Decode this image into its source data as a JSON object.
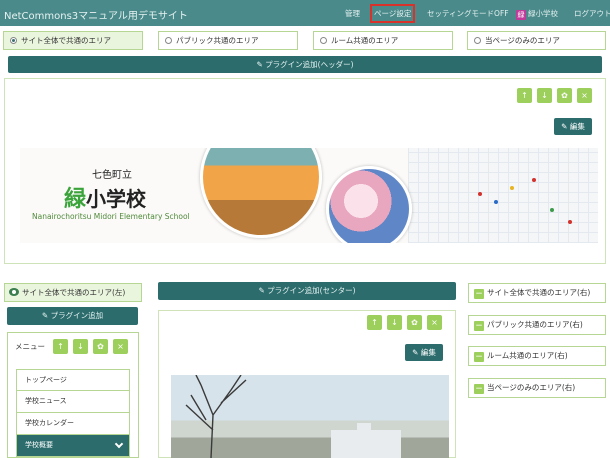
{
  "navbar": {
    "brand": "NetCommons3マニュアル用デモサイト",
    "items": {
      "manage": "管理",
      "page_settings": "ページ設定",
      "setting_mode_off": "セッティングモードOFF",
      "user_badge": "緑",
      "user_name": "緑小学校",
      "logout": "ログアウト"
    }
  },
  "areas": {
    "site_wide": "サイト全体で共通のエリア",
    "public": "パブリック共通のエリア",
    "room": "ルーム共通のエリア",
    "this_page": "当ページのみのエリア"
  },
  "header": {
    "add_plugin": "プラグイン追加(ヘッダー)",
    "edit": "編集"
  },
  "banner": {
    "town": "七色町立",
    "school_first_char": "緑",
    "school_rest": "小学校",
    "school_en": "Nanairochoritsu Midori Elementary School"
  },
  "left_column": {
    "area_label": "サイト全体で共通のエリア(左)",
    "add_plugin": "プラグイン追加",
    "menu_title": "メニュー",
    "menu_items": [
      "トップページ",
      "学校ニュース",
      "学校カレンダー",
      "学校概要"
    ]
  },
  "center_column": {
    "add_plugin": "プラグイン追加(センター)",
    "edit": "編集"
  },
  "right_column": {
    "items": [
      "サイト全体で共通のエリア(右)",
      "パブリック共通のエリア(右)",
      "ルーム共通のエリア(右)",
      "当ページのみのエリア(右)"
    ]
  },
  "icons": {
    "up": "↑",
    "down": "↓",
    "gear": "✿",
    "close": "×",
    "pin": "✎",
    "edit": "✎",
    "minus": "−"
  },
  "colors": {
    "navbar": "#4b8a8a",
    "teal_button": "#2c6c6c",
    "green_control": "#9ccf5b",
    "area_border": "#b6d693",
    "active_area": "#eaf5dd",
    "highlight": "#d9322a"
  }
}
